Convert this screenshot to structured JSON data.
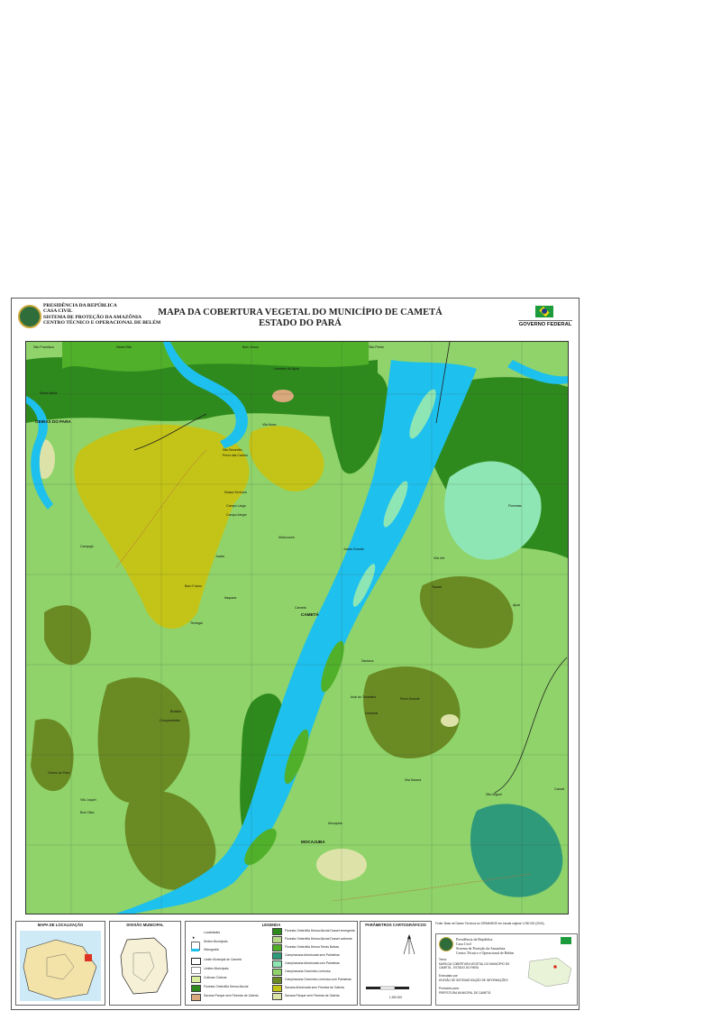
{
  "header": {
    "org_lines": [
      "PRESIDÊNCIA DA REPÚBLICA",
      "CASA CIVIL",
      "SISTEMA DE PROTEÇÃO DA AMAZÔNIA",
      "CENTRO TÉCNICO E OPERACIONAL DE BELÉM"
    ],
    "title_line1": "MAPA DA COBERTURA VEGETAL DO MUNICÍPIO DE CAMETÁ",
    "title_line2": "ESTADO DO PARÁ",
    "gov_label": "GOVERNO FEDERAL"
  },
  "map": {
    "region_label": "OEIRAS DO PARA",
    "places": [
      "São Francisco",
      "Santa Rita",
      "Bom Jesus",
      "São Pedro",
      "Santa Maria",
      "Limoeiro do Ajuru",
      "Vila Nova",
      "São Benedito",
      "Porto das Cardos",
      "Nossa Senhora",
      "Campo Largo",
      "Campo Alegre",
      "Mutucuvea",
      "Juaba",
      "Bom Futuro",
      "Itaquara",
      "Carapajó",
      "Tentugal",
      "Brasília",
      "Curuçambaba",
      "Porto Grande",
      "Ilha Saracá",
      "Carmo do Pará",
      "Vila Ulé",
      "Santana",
      "Umarizal",
      "Aval do Tocantins",
      "Mocajuba",
      "Cametá",
      "Juaba Grande",
      "São Miguel",
      "Ajuaí",
      "Florestas",
      "Boa Vista",
      "Vila Juquiri",
      "Tauaré",
      "Cacoal"
    ],
    "city_labels": [
      "CAMETÁ",
      "MOCAJUBA"
    ]
  },
  "panels": {
    "location_title": "MAPA DE LOCALIZAÇÃO",
    "division_title": "DIVISÃO MUNICIPAL",
    "legend_title": "LEGENDA",
    "params_title": "PARÂMETROS CARTOGRÁFICOS",
    "scale_text": "1:250.000",
    "source_note": "Fonte: Base de Dados Técnicos do SIPAM/IBGE em escala original 1:250.000 (2004).",
    "info_org": [
      "Presidência da República",
      "Casa Civil",
      "Sistema de Proteção da Amazônia",
      "Centro Técnico e Operacional de Belém"
    ],
    "info_theme_label": "Tema:",
    "info_theme": "MAPA DA COBERTURA VEGETAL DO MUNICÍPIO DE CAMETÁ - ESTADO DO PARÁ",
    "info_exec_label": "Executado por:",
    "info_exec": "DIVISÃO DE SISTEMATIZAÇÃO DE INFORMAÇÕES",
    "info_prod_label": "Produzido para:",
    "info_prod": "PREFEITURA MUNICIPAL DE CAMETÁ"
  },
  "legend": {
    "left": [
      "Localidades",
      "Sedes Municipais",
      "Hidrografia",
      "Limite Municipal de Cametá",
      "Limites Municipais",
      "Culturas Cíclicas",
      "Floresta Ombrófila Densa Aluvial",
      "Savana Parque sem Floresta de Galeria"
    ],
    "right": [
      "Floresta Ombrófila Densa Aluvial Dossel emergente",
      "Floresta Ombrófila Densa Aluvial Dossel uniforme",
      "Floresta Ombrófila Densa Terras Baixas",
      "Campinarana Arborizada sem Palmeiras",
      "Campinarana Arborizada com Palmeiras",
      "Campinarana Gramíneo-Lenhosa",
      "Campinarana Gramíneo-Lenhosa com Palmeiras",
      "Savana Arborizada sem Floresta de Galeria",
      "Savana Parque sem Floresta de Galeria"
    ],
    "colors": {
      "river": "#1ec0ee",
      "forest_dark": "#2f8a1e",
      "forest_mid": "#50b02a",
      "lowland": "#8fd36a",
      "savanna_yellow": "#c4c418",
      "secondary": "#6a8a24",
      "campinarana": "#8ee6b4",
      "agriculture": "#d9a87c",
      "cream": "#dde3a8"
    }
  }
}
